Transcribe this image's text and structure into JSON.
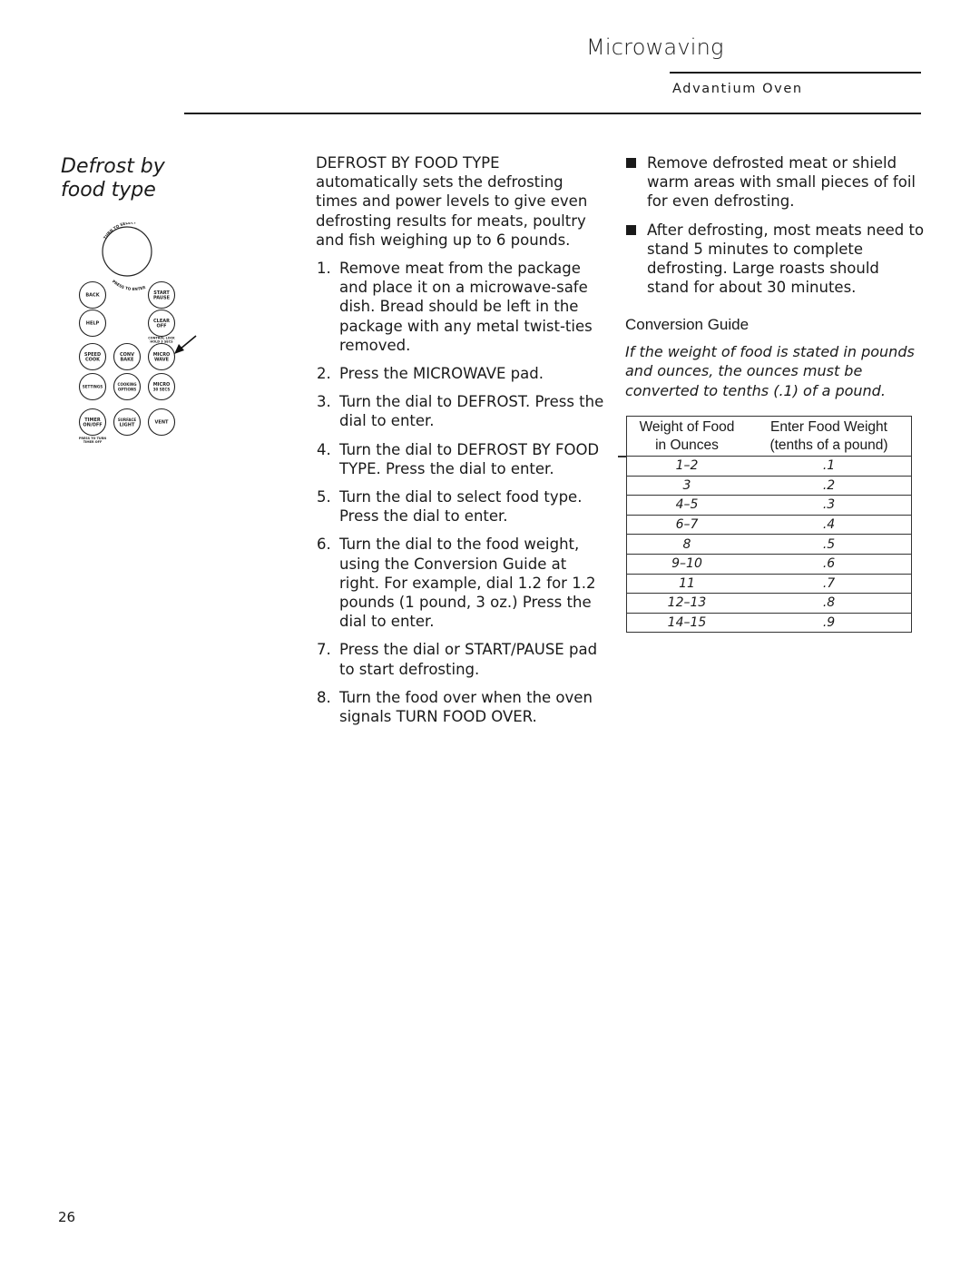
{
  "header": {
    "section": "Microwaving",
    "subtitle": "Advantium Oven"
  },
  "section_title": {
    "line1": "Defrost by",
    "line2": "food type"
  },
  "control_panel": {
    "dial": {
      "top_label": "TURN TO SELECT",
      "bottom_label": "PRESS TO ENTER"
    },
    "pads": [
      {
        "id": "back",
        "line1": "BACK",
        "line2": ""
      },
      {
        "id": "start-pause",
        "line1": "START",
        "line2": "PAUSE"
      },
      {
        "id": "help",
        "line1": "HELP",
        "line2": ""
      },
      {
        "id": "clear-off",
        "line1": "CLEAR",
        "line2": "OFF"
      },
      {
        "id": "speed-cook",
        "line1": "SPEED",
        "line2": "COOK"
      },
      {
        "id": "conv-bake",
        "line1": "CONV",
        "line2": "BAKE"
      },
      {
        "id": "micro-wave",
        "line1": "MICRO",
        "line2": "WAVE"
      },
      {
        "id": "settings",
        "line1": "SETTINGS",
        "line2": ""
      },
      {
        "id": "cooking-options",
        "line1": "COOKING",
        "line2": "OPTIONS"
      },
      {
        "id": "micro-30-secs",
        "line1": "MICRO",
        "line2": "30 SECS"
      },
      {
        "id": "timer",
        "line1": "TIMER",
        "line2": "ON/OFF"
      },
      {
        "id": "surface-light",
        "line1": "SURFACE",
        "line2": "LIGHT"
      },
      {
        "id": "vent",
        "line1": "VENT",
        "line2": ""
      }
    ],
    "notes": {
      "clear_line1": "CONTROL LOCK",
      "clear_line2": "HOLD 3 SECS",
      "timer_line1": "PRESS TO TURN",
      "timer_line2": "TIMER OFF"
    },
    "highlighted_pad": "micro-wave"
  },
  "intro": "DEFROST BY FOOD TYPE automatically sets the defrosting times and power levels to give even defrosting results for meats, poultry and fish weighing up to 6 pounds.",
  "steps": [
    {
      "num": "1.",
      "text": "Remove meat from the package and place it on a microwave-safe dish.  Bread should be left in the package with any metal twist-ties removed."
    },
    {
      "num": "2.",
      "text": "Press the MICROWAVE pad."
    },
    {
      "num": "3.",
      "text": "Turn the dial to DEFROST. Press the dial to enter."
    },
    {
      "num": "4.",
      "text": "Turn the dial to DEFROST BY FOOD TYPE. Press the dial to enter."
    },
    {
      "num": "5.",
      "text": "Turn the dial to select food type. Press the dial to enter."
    },
    {
      "num": "6.",
      "text": "Turn the dial to the food weight, using the Conversion Guide at right. For example, dial 1.2 for 1.2 pounds (1 pound, 3 oz.) Press the dial to enter."
    },
    {
      "num": "7.",
      "text": "Press the dial or START/PAUSE pad to start defrosting."
    },
    {
      "num": "8.",
      "text": "Turn the food over when the oven signals TURN FOOD OVER."
    }
  ],
  "tips": [
    "Remove defrosted meat or shield warm areas with small pieces of foil for even defrosting.",
    "After defrosting, most meats need to stand 5 minutes to complete defrosting. Large roasts should stand for about 30 minutes."
  ],
  "conversion_guide": {
    "heading": "Conversion Guide",
    "note": "If the weight of food is stated in pounds and ounces, the ounces must be converted to tenths (.1) of a pound.",
    "columns": [
      {
        "line1": "Weight of Food",
        "line2": "in Ounces"
      },
      {
        "line1": "Enter Food Weight",
        "line2": "(tenths of a pound)"
      }
    ],
    "rows": [
      {
        "ounces": "1–2",
        "tenths": ".1"
      },
      {
        "ounces": "3",
        "tenths": ".2"
      },
      {
        "ounces": "4–5",
        "tenths": ".3"
      },
      {
        "ounces": "6–7",
        "tenths": ".4"
      },
      {
        "ounces": "8",
        "tenths": ".5"
      },
      {
        "ounces": "9–10",
        "tenths": ".6"
      },
      {
        "ounces": "11",
        "tenths": ".7"
      },
      {
        "ounces": "12–13",
        "tenths": ".8"
      },
      {
        "ounces": "14–15",
        "tenths": ".9"
      }
    ]
  },
  "page_number": "26"
}
